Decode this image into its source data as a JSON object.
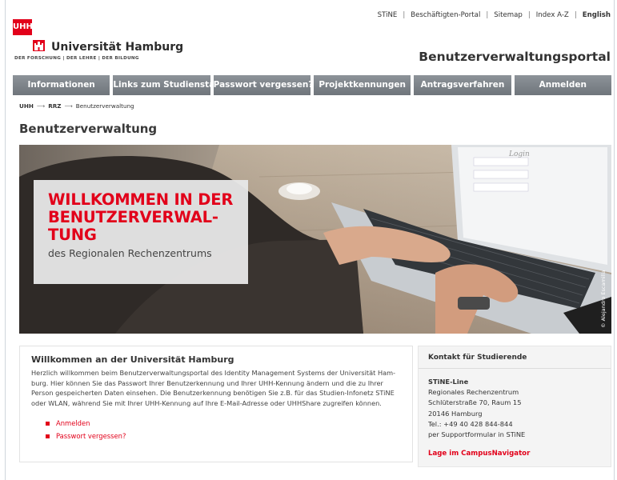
{
  "toplinks": [
    "STiNE",
    "Beschäftigten-Portal",
    "Sitemap",
    "Index A-Z",
    "English"
  ],
  "logo": {
    "mark": "UHH",
    "name": "Universität Hamburg",
    "tagline": "DER FORSCHUNG | DER LEHRE | DER BILDUNG"
  },
  "portal_title": "Benutzerverwaltungsportal",
  "nav": [
    "Informationen",
    "Links zum Studienstart",
    "Passwort vergessen?",
    "Projektkennungen",
    "Antragsverfahren",
    "Anmelden"
  ],
  "breadcrumb": {
    "root": "UHH",
    "mid": "RRZ",
    "current": "Benutzerverwaltung",
    "separator": "⟶"
  },
  "page_title": "Benutzerverwaltung",
  "hero": {
    "headline_lines": [
      "WILLKOMMEN IN DER",
      "BENUTZERVERWAL-",
      "TUNG"
    ],
    "subline": "des Regionalen Rechenzentrums",
    "screen_label": "Login",
    "credit": "© Alejandro Escamilla"
  },
  "welcome": {
    "title": "Willkommen an der Universität Hamburg",
    "text": "Herzlich willkommen beim Benutzerverwaltungsportal des Identity Management Systems der Universität Ham-burg. Hier können Sie das Passwort Ihrer Benutzerkennung und Ihrer UHH-Kennung ändern und die zu Ihrer Person gespeicherten Daten einsehen. Die Benutzerkennung benötigen Sie z.B. für das Studien-Infonetz STiNE oder WLAN, während Sie mit Ihrer UHH-Kennung auf Ihre E-Mail-Adresse oder UHHShare zugreifen können.",
    "links": [
      "Anmelden",
      "Passwort vergessen?"
    ]
  },
  "contact": {
    "title": "Kontakt für Studierende",
    "name": "STiNE-Line",
    "lines": [
      "Regionales Rechenzentrum",
      "Schlüterstraße 70, Raum 15",
      "20146 Hamburg",
      "Tel.: +49 40 428 844-844",
      "per Supportformular in STiNE"
    ],
    "link": "Lage im CampusNavigator"
  },
  "colors": {
    "accent": "#e2001a",
    "nav": "#7d8389",
    "text": "#333333"
  }
}
